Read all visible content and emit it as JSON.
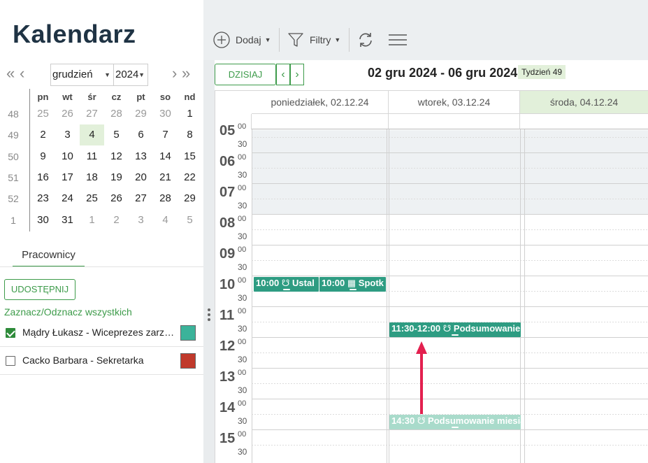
{
  "app_title": "Kalendarz",
  "mini_calendar": {
    "nav_prev_year": "«",
    "nav_prev_month": "‹",
    "nav_next_month": "›",
    "nav_next_year": "»",
    "month": "grudzień",
    "year": "2024",
    "weekday_headers": [
      "pn",
      "wt",
      "śr",
      "cz",
      "pt",
      "so",
      "nd"
    ],
    "weeks": [
      {
        "num": "48",
        "days": [
          "25",
          "26",
          "27",
          "28",
          "29",
          "30",
          "1"
        ]
      },
      {
        "num": "49",
        "days": [
          "2",
          "3",
          "4",
          "5",
          "6",
          "7",
          "8"
        ]
      },
      {
        "num": "50",
        "days": [
          "9",
          "10",
          "11",
          "12",
          "13",
          "14",
          "15"
        ]
      },
      {
        "num": "51",
        "days": [
          "16",
          "17",
          "18",
          "19",
          "20",
          "21",
          "22"
        ]
      },
      {
        "num": "52",
        "days": [
          "23",
          "24",
          "25",
          "26",
          "27",
          "28",
          "29"
        ]
      },
      {
        "num": "1",
        "days": [
          "30",
          "31",
          "1",
          "2",
          "3",
          "4",
          "5"
        ]
      }
    ]
  },
  "sidebar": {
    "tab_employees": "Pracownicy",
    "share_button": "UDOSTĘPNIJ",
    "select_all": "Zaznacz/Odznacz wszystkich",
    "employees": [
      {
        "name": "Mądry Łukasz - Wiceprezes zarządu",
        "checked": true,
        "color": "#3bb39a"
      },
      {
        "name": "Cacko Barbara - Sekretarka",
        "checked": false,
        "color": "#c0392b"
      }
    ]
  },
  "toolbar": {
    "add_label": "Dodaj",
    "filters_label": "Filtry"
  },
  "calendar_header": {
    "today_button": "DZISIAJ",
    "prev": "‹",
    "next": "›",
    "range": "02 gru 2024 - 06 gru 2024",
    "week_badge": "Tydzień 49"
  },
  "day_columns": [
    {
      "label": "poniedziałek, 02.12.24",
      "today": false
    },
    {
      "label": "wtorek, 03.12.24",
      "today": false
    },
    {
      "label": "środa, 04.12.24",
      "today": true
    }
  ],
  "hours": [
    "05",
    "06",
    "07",
    "08",
    "09",
    "10",
    "11",
    "12",
    "13",
    "14",
    "15"
  ],
  "minute_marks": [
    "00",
    "30"
  ],
  "events": [
    {
      "time": "10:00",
      "icon": "☋",
      "title": "Ustal",
      "day": 0,
      "part": 0
    },
    {
      "time": "10:00",
      "icon": "▦",
      "title": "Spotk",
      "day": 0,
      "part": 1
    },
    {
      "time": "11:30-12:00",
      "icon": "☋",
      "title": "Podsumowanie",
      "day": 1
    },
    {
      "time": "14:30",
      "icon": "☋",
      "title": "Podsumowanie miesiąca",
      "day": 1,
      "ghost": true
    }
  ]
}
